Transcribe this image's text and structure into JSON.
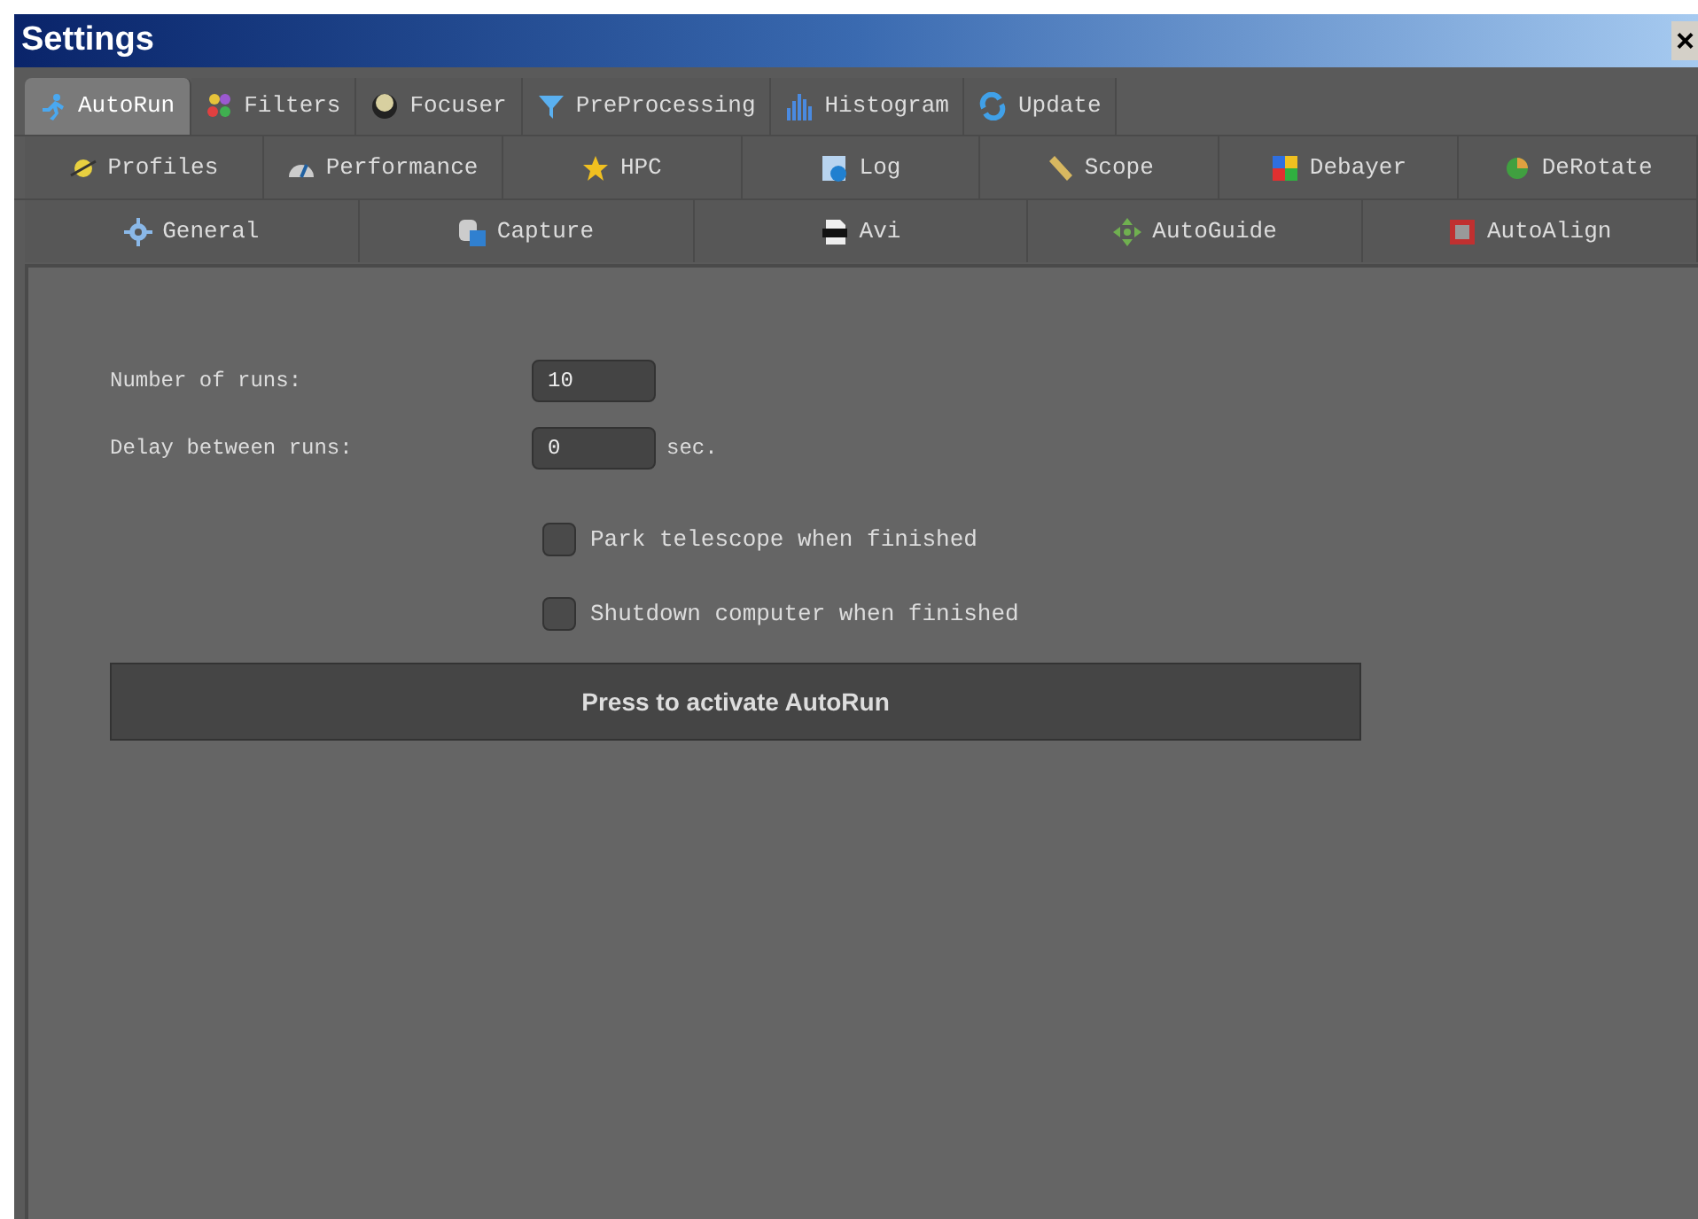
{
  "window": {
    "title": "Settings",
    "close": "×"
  },
  "tab_rows": [
    [
      {
        "label": "AutoRun",
        "selected": true
      },
      {
        "label": "Filters",
        "selected": false
      },
      {
        "label": "Focuser",
        "selected": false
      },
      {
        "label": "PreProcessing",
        "selected": false
      },
      {
        "label": "Histogram",
        "selected": false
      },
      {
        "label": "Update",
        "selected": false
      }
    ],
    [
      {
        "label": "Profiles",
        "selected": false
      },
      {
        "label": "Performance",
        "selected": false
      },
      {
        "label": "HPC",
        "selected": false
      },
      {
        "label": "Log",
        "selected": false
      },
      {
        "label": "Scope",
        "selected": false
      },
      {
        "label": "Debayer",
        "selected": false
      },
      {
        "label": "DeRotate",
        "selected": false
      }
    ],
    [
      {
        "label": "General",
        "selected": false
      },
      {
        "label": "Capture",
        "selected": false
      },
      {
        "label": "Avi",
        "selected": false
      },
      {
        "label": "AutoGuide",
        "selected": false
      },
      {
        "label": "AutoAlign",
        "selected": false
      }
    ]
  ],
  "fields": [
    {
      "label": "Number of runs:",
      "value": "10"
    },
    {
      "label": "Delay between runs:",
      "value": "0",
      "unit": "sec."
    }
  ],
  "checkboxes": [
    {
      "label": "Park telescope when finished",
      "checked": false
    },
    {
      "label": "Shutdown computer when finished",
      "checked": false
    }
  ],
  "activate_button": "Press to activate AutoRun"
}
